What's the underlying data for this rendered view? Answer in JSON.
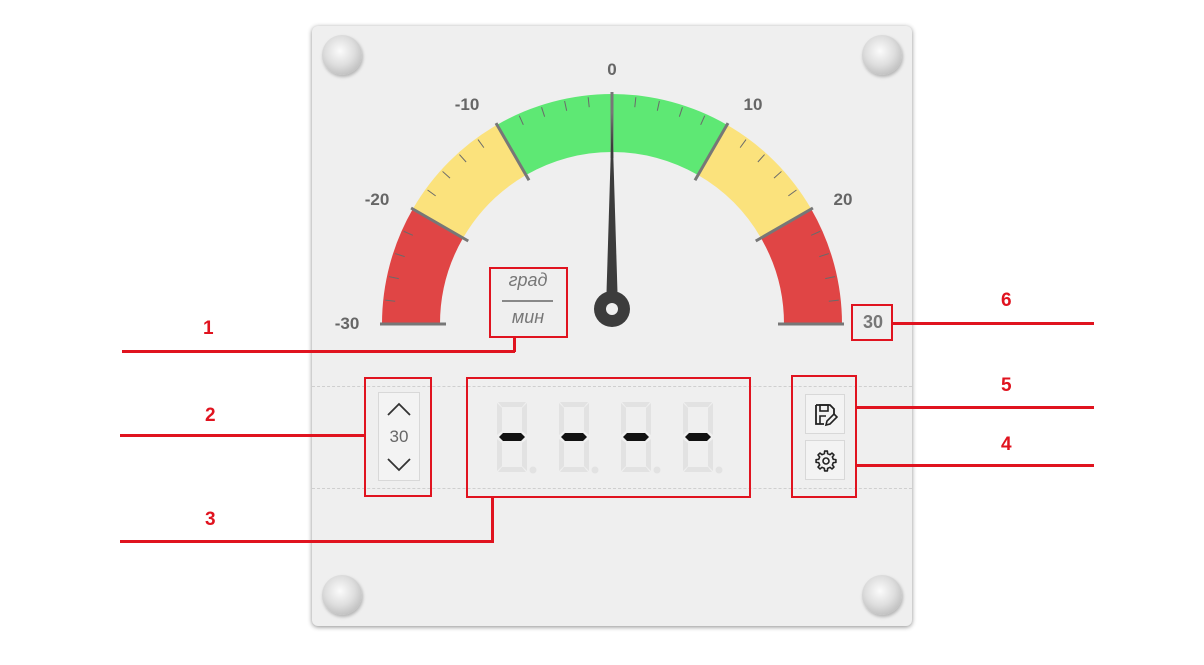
{
  "gauge": {
    "scale_labels": [
      "-30",
      "-20",
      "-10",
      "0",
      "10",
      "20",
      "30"
    ],
    "zones": [
      {
        "from": -30,
        "to": -20,
        "color": "#e04545",
        "name": "danger-low"
      },
      {
        "from": -20,
        "to": -10,
        "color": "#fbe27c",
        "name": "warning-low"
      },
      {
        "from": -10,
        "to": 10,
        "color": "#5ee874",
        "name": "normal"
      },
      {
        "from": 10,
        "to": 20,
        "color": "#fbe27c",
        "name": "warning-high"
      },
      {
        "from": 20,
        "to": 30,
        "color": "#e04545",
        "name": "danger-high"
      }
    ],
    "needle_value": 0,
    "unit_numerator": "град",
    "unit_denominator": "мин",
    "max_value": "30"
  },
  "controls": {
    "range_value": "30",
    "up_icon": "chevron-up-icon",
    "down_icon": "chevron-down-icon",
    "display_digits": [
      "-",
      "-",
      "-",
      "-"
    ],
    "save_icon": "save-edit-icon",
    "settings_icon": "gear-icon"
  },
  "annotations": [
    "1",
    "2",
    "3",
    "4",
    "5",
    "6"
  ],
  "colors": {
    "annotation": "#e0131f",
    "needle": "#3c3c3c",
    "panel": "#efefef"
  }
}
